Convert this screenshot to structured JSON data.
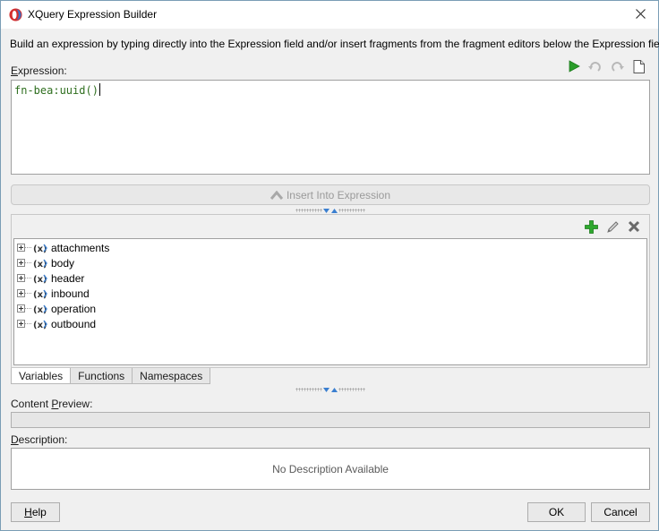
{
  "window": {
    "title": "XQuery Expression Builder"
  },
  "intro": "Build an expression by typing directly into the Expression field and/or insert fragments from the fragment editors below the Expression field.",
  "expression": {
    "label_mnemonic": "E",
    "label_rest": "xpression:",
    "value": "fn-bea:uuid()"
  },
  "insert_button": "Insert Into Expression",
  "variables": [
    {
      "label": "attachments"
    },
    {
      "label": "body"
    },
    {
      "label": "header"
    },
    {
      "label": "inbound"
    },
    {
      "label": "operation"
    },
    {
      "label": "outbound"
    }
  ],
  "tabs": [
    {
      "label": "Variables",
      "active": true
    },
    {
      "label": "Functions",
      "active": false
    },
    {
      "label": "Namespaces",
      "active": false
    }
  ],
  "content_preview": {
    "label_pre": "Content ",
    "label_mnemonic": "P",
    "label_post": "review:",
    "value": ""
  },
  "description": {
    "label_mnemonic": "D",
    "label_rest": "escription:",
    "text": "No Description Available"
  },
  "buttons": {
    "help_mnemonic": "H",
    "help_rest": "elp",
    "ok": "OK",
    "cancel": "Cancel"
  },
  "colors": {
    "run_green": "#2a9d2a",
    "add_green": "#2ea82e",
    "expression_text": "#2e6e1e",
    "splitter_arrow": "#3b7fd0"
  }
}
